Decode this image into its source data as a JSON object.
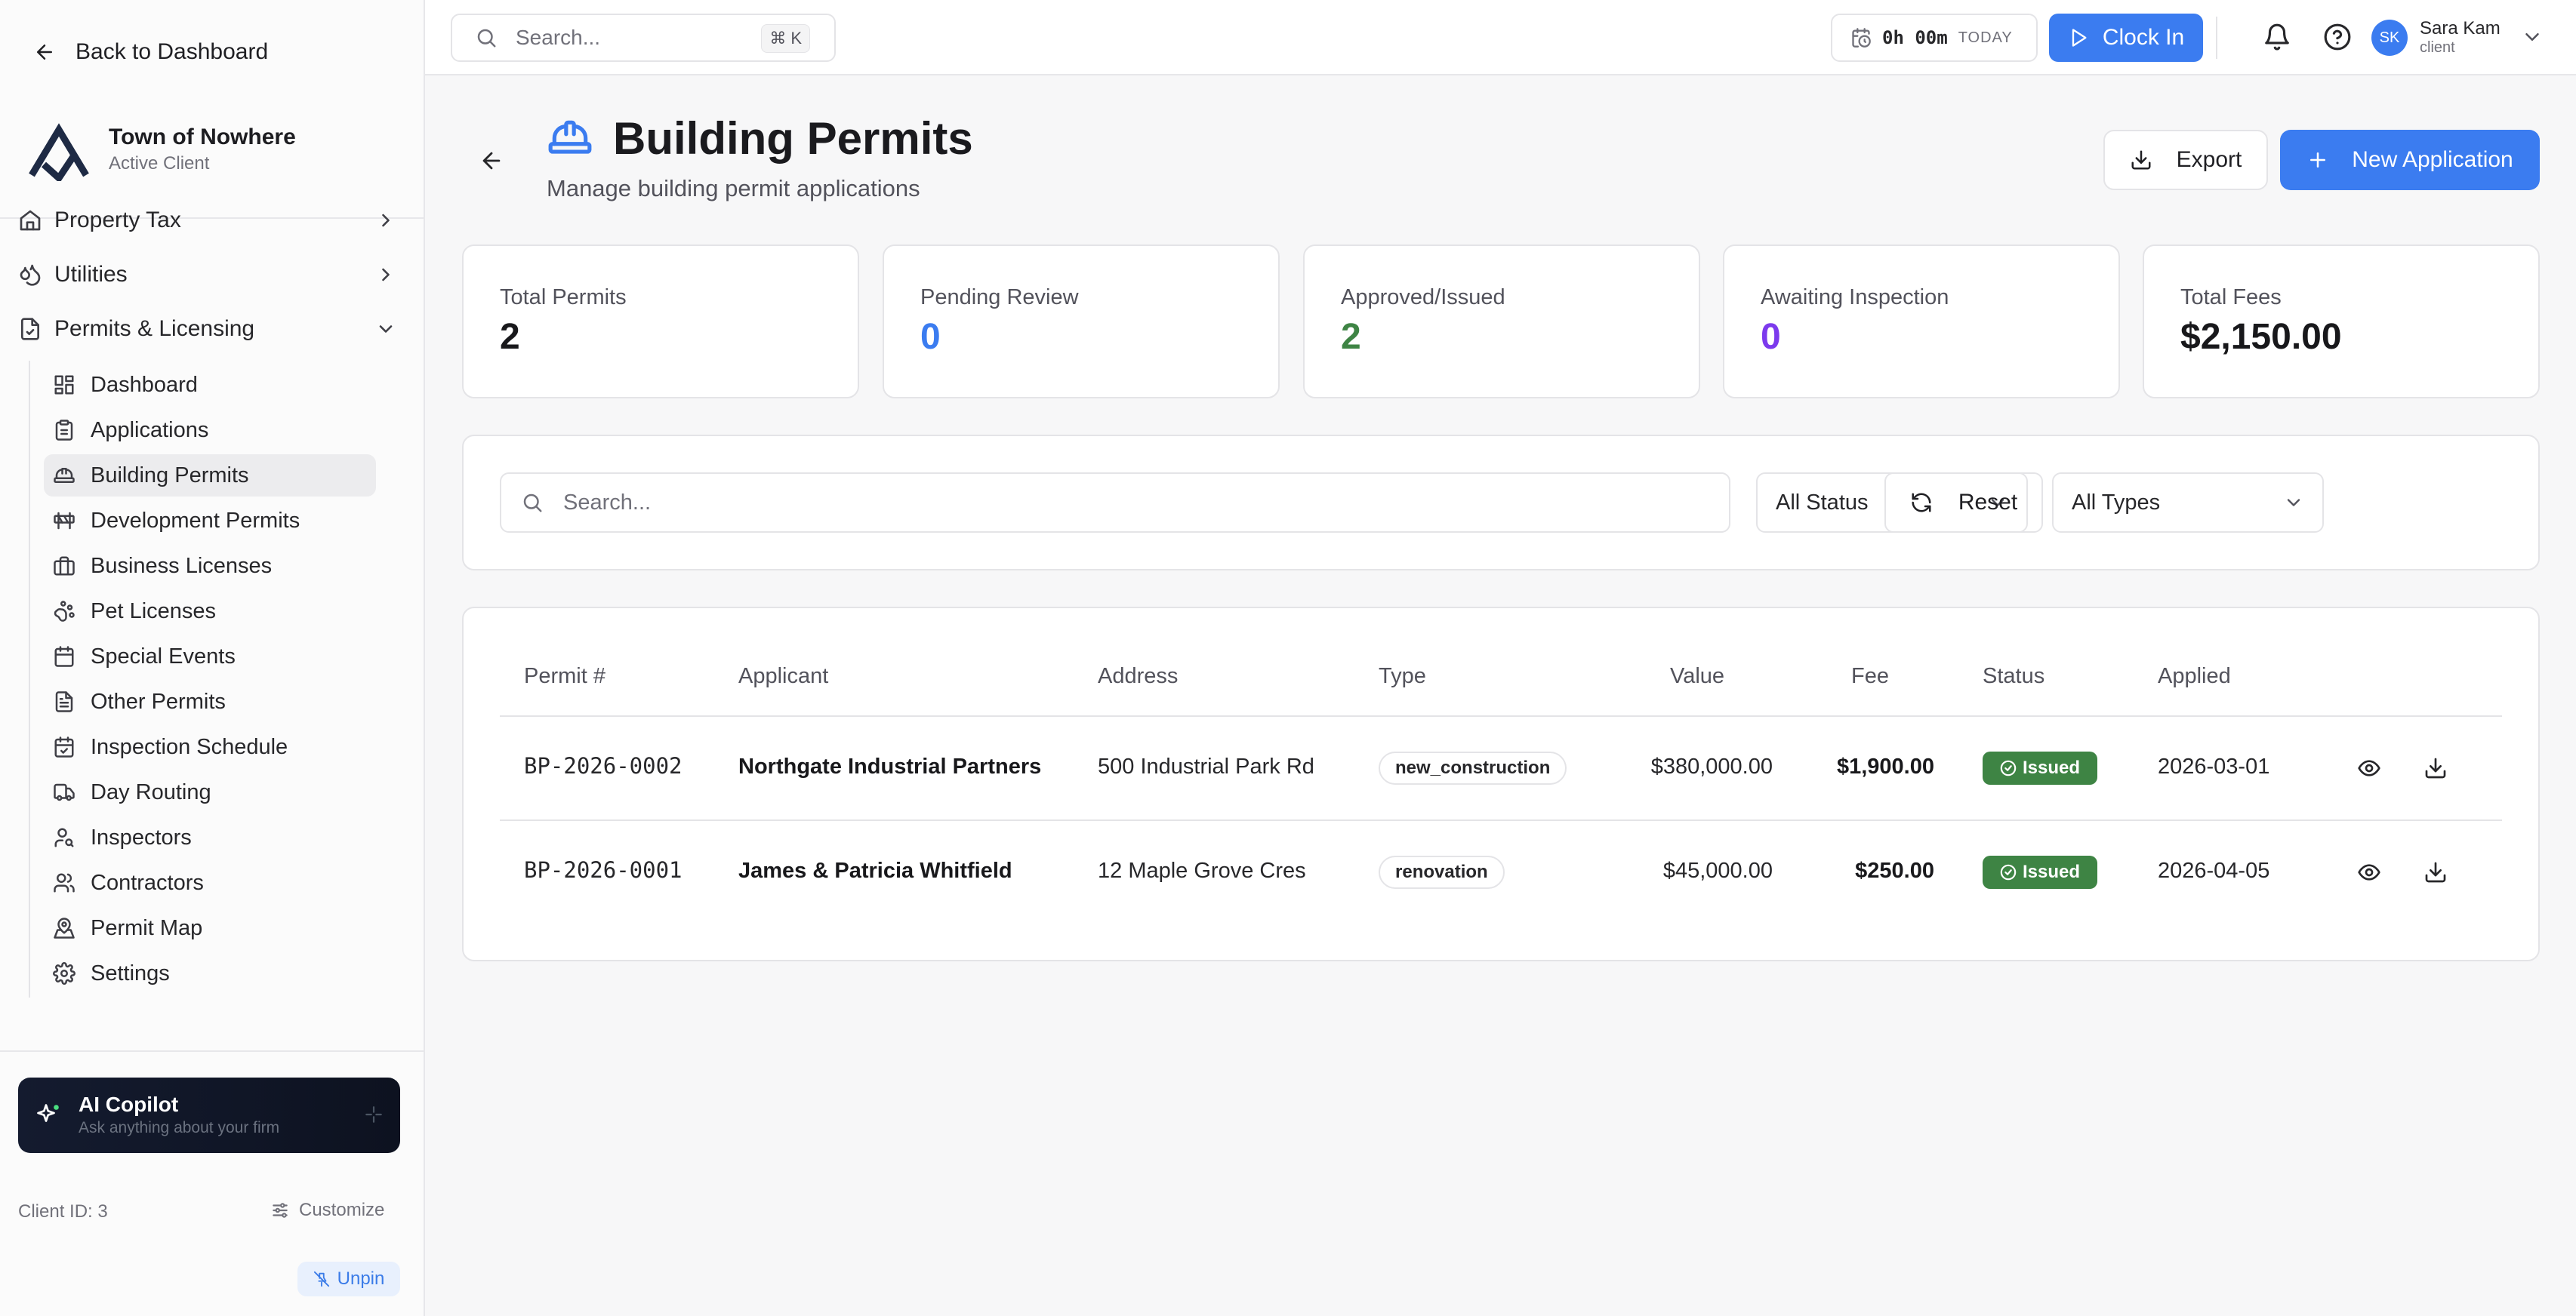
{
  "sidebar": {
    "back_label": "Back to Dashboard",
    "brand_name": "Town of Nowhere",
    "brand_sub": "Active Client",
    "top_items": [
      {
        "label": "Property Tax",
        "expanded": false
      },
      {
        "label": "Utilities",
        "expanded": false
      },
      {
        "label": "Permits & Licensing",
        "expanded": true
      }
    ],
    "sub_items": [
      {
        "label": "Dashboard",
        "icon": "dashboard-icon"
      },
      {
        "label": "Applications",
        "icon": "clipboard-icon"
      },
      {
        "label": "Building Permits",
        "icon": "hard-hat-icon",
        "active": true
      },
      {
        "label": "Development Permits",
        "icon": "barrier-icon"
      },
      {
        "label": "Business Licenses",
        "icon": "briefcase-icon"
      },
      {
        "label": "Pet Licenses",
        "icon": "paw-icon"
      },
      {
        "label": "Special Events",
        "icon": "calendar-icon"
      },
      {
        "label": "Other Permits",
        "icon": "file-text-icon"
      },
      {
        "label": "Inspection Schedule",
        "icon": "calendar-check-icon"
      },
      {
        "label": "Day Routing",
        "icon": "truck-icon"
      },
      {
        "label": "Inspectors",
        "icon": "user-search-icon"
      },
      {
        "label": "Contractors",
        "icon": "users-icon"
      },
      {
        "label": "Permit Map",
        "icon": "map-pin-icon"
      },
      {
        "label": "Settings",
        "icon": "gear-icon"
      }
    ],
    "copilot_title": "AI Copilot",
    "copilot_sub": "Ask anything about your firm",
    "client_id": "Client ID: 3",
    "customize_label": "Customize",
    "unpin_label": "Unpin"
  },
  "topbar": {
    "search_placeholder": "Search...",
    "shortcut_symbol": "⌘",
    "shortcut_key": "K",
    "timer_value": "0h 00m",
    "timer_label": "TODAY",
    "clock_in_label": "Clock In",
    "user_initials": "SK",
    "user_name": "Sara Kam",
    "user_role": "client"
  },
  "header": {
    "title": "Building Permits",
    "subtitle": "Manage building permit applications",
    "export_label": "Export",
    "new_label": "New Application"
  },
  "stats": [
    {
      "label": "Total Permits",
      "value": "2",
      "color": "#18181b"
    },
    {
      "label": "Pending Review",
      "value": "0",
      "color": "#3b7cf0"
    },
    {
      "label": "Approved/Issued",
      "value": "2",
      "color": "#3e8444"
    },
    {
      "label": "Awaiting Inspection",
      "value": "0",
      "color": "#7c3aed"
    },
    {
      "label": "Total Fees",
      "value": "$2,150.00",
      "color": "#18181b"
    }
  ],
  "filters": {
    "search_placeholder": "Search...",
    "status_value": "All Status",
    "type_value": "All Types",
    "reset_label": "Reset"
  },
  "table": {
    "headers": [
      "Permit #",
      "Applicant",
      "Address",
      "Type",
      "Value",
      "Fee",
      "Status",
      "Applied"
    ],
    "rows": [
      {
        "permit": "BP-2026-0002",
        "applicant": "Northgate Industrial Partners",
        "address": "500 Industrial Park Rd",
        "type": "new_construction",
        "value": "$380,000.00",
        "fee": "$1,900.00",
        "status": "Issued",
        "applied": "2026-03-01"
      },
      {
        "permit": "BP-2026-0001",
        "applicant": "James & Patricia Whitfield",
        "address": "12 Maple Grove Cres",
        "type": "renovation",
        "value": "$45,000.00",
        "fee": "$250.00",
        "status": "Issued",
        "applied": "2026-04-05"
      }
    ]
  },
  "colors": {
    "accent": "#3b7cf0",
    "success": "#3e8444",
    "purple": "#7c3aed"
  }
}
